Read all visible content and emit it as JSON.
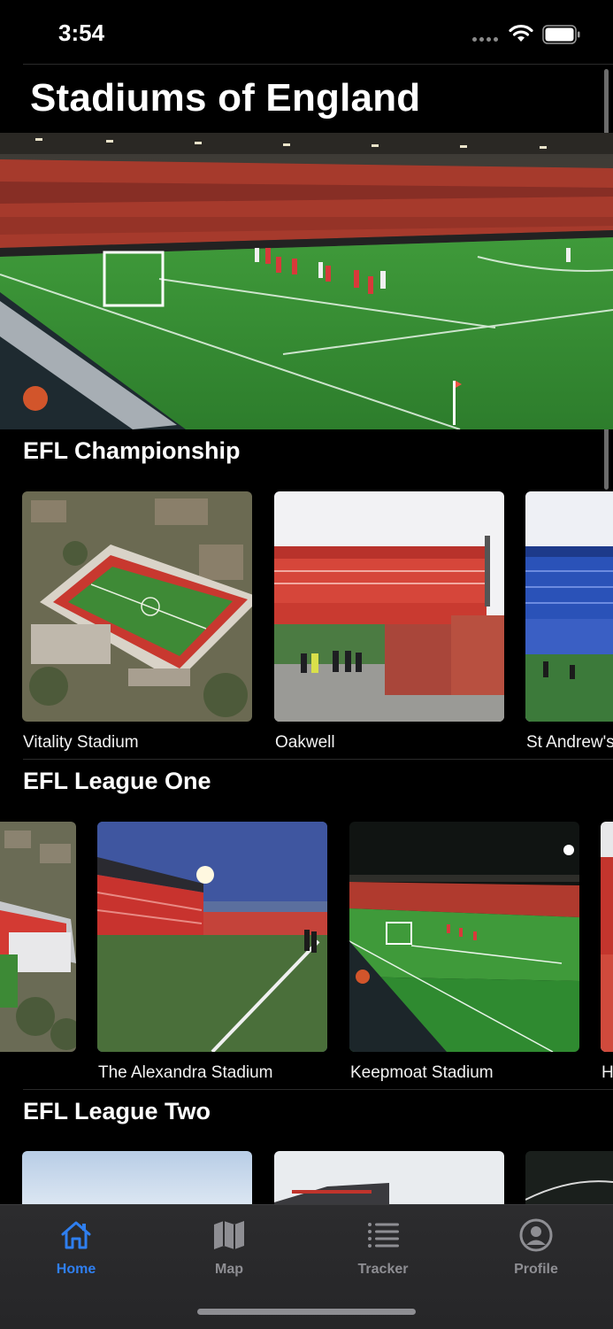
{
  "status_bar": {
    "time": "3:54"
  },
  "app": {
    "title": "Stadiums of England"
  },
  "hero": {
    "image": "stadium-floodlit-pitch-photo"
  },
  "sections": [
    {
      "title": "EFL Championship",
      "stadiums": [
        {
          "name": "Vitality Stadium",
          "image": "aerial-stadium-photo"
        },
        {
          "name": "Oakwell",
          "image": "red-stand-stadium-photo"
        },
        {
          "name": "St Andrew's",
          "image": "blue-seats-stadium-photo"
        }
      ]
    },
    {
      "title": "EFL League One",
      "stadiums": [
        {
          "name": "",
          "image": "aerial-red-roof-stadium-photo"
        },
        {
          "name": "The Alexandra Stadium",
          "image": "dusk-stadium-photo"
        },
        {
          "name": "Keepmoat Stadium",
          "image": "night-match-photo"
        },
        {
          "name": "H",
          "image": "partial-stadium-photo"
        }
      ]
    },
    {
      "title": "EFL League Two",
      "stadiums": [
        {
          "name": "",
          "image": "sky-photo"
        },
        {
          "name": "",
          "image": "stand-roof-photo"
        },
        {
          "name": "",
          "image": "dark-roof-photo"
        }
      ]
    }
  ],
  "tab_bar": {
    "tabs": [
      {
        "label": "Home",
        "icon": "house-icon",
        "active": true
      },
      {
        "label": "Map",
        "icon": "map-icon",
        "active": false
      },
      {
        "label": "Tracker",
        "icon": "list-icon",
        "active": false
      },
      {
        "label": "Profile",
        "icon": "person-circle-icon",
        "active": false
      }
    ]
  },
  "colors": {
    "accent": "#2f7ff0",
    "inactive": "#8e8e93",
    "background": "#000000"
  }
}
